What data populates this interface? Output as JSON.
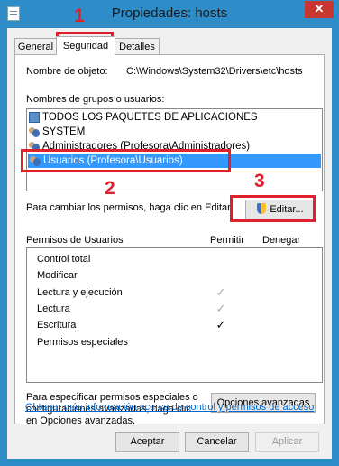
{
  "window": {
    "title": "Propiedades: hosts",
    "close_glyph": "✕"
  },
  "tabs": [
    {
      "label": "General"
    },
    {
      "label": "Seguridad"
    },
    {
      "label": "Detalles"
    }
  ],
  "object": {
    "label": "Nombre de objeto:",
    "value": "C:\\Windows\\System32\\Drivers\\etc\\hosts"
  },
  "groups": {
    "label": "Nombres de grupos o usuarios:",
    "items": [
      {
        "label": "TODOS LOS PAQUETES DE APLICACIONES",
        "icon": "package-icon"
      },
      {
        "label": "SYSTEM",
        "icon": "users-icon"
      },
      {
        "label": "Administradores (Profesora\\Administradores)",
        "icon": "users-icon"
      },
      {
        "label": "Usuarios (Profesora\\Usuarios)",
        "icon": "users-icon",
        "selected": true
      }
    ]
  },
  "edit": {
    "hint": "Para cambiar los permisos, haga clic en Editar.",
    "button": "Editar..."
  },
  "permissions": {
    "header": "Permisos de Usuarios",
    "allow_header": "Permitir",
    "deny_header": "Denegar",
    "rows": [
      {
        "name": "Control total",
        "allow": ""
      },
      {
        "name": "Modificar",
        "allow": ""
      },
      {
        "name": "Lectura y ejecución",
        "allow": "✓"
      },
      {
        "name": "Lectura",
        "allow": "✓"
      },
      {
        "name": "Escritura",
        "allow": "✓"
      },
      {
        "name": "Permisos especiales",
        "allow": ""
      }
    ]
  },
  "advanced": {
    "hint_lines": [
      "Para especificar permisos especiales o",
      "configuraciones avanzadas, haga clic",
      "en Opciones avanzadas."
    ],
    "button": "Opciones avanzadas",
    "link": "Obtener más información acerca de control y permisos de acceso"
  },
  "footer": {
    "accept": "Aceptar",
    "cancel": "Cancelar",
    "apply": "Aplicar"
  },
  "annotations": {
    "one": "1",
    "two": "2",
    "three": "3",
    "color": "#e0202a"
  },
  "colors": {
    "frame": "#2e8dc8",
    "selection": "#3399ff",
    "close": "#c7372f"
  }
}
